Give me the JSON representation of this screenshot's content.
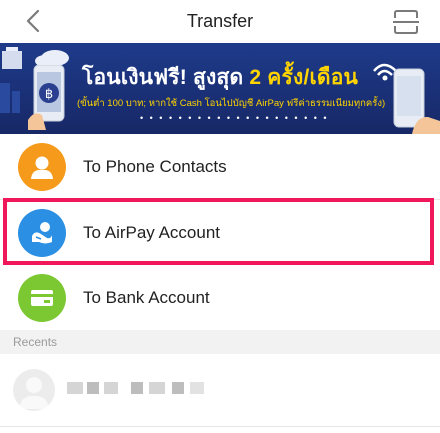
{
  "header": {
    "title": "Transfer",
    "back_icon": "chevron-left-icon",
    "scan_icon": "qr-scan-icon"
  },
  "banner": {
    "headline_part1": "โอนเงินฟรี! สูงสุด ",
    "headline_part2": "2 ครั้ง/เดือน",
    "subtext": "(ขั้นต่ำ 100 บาท; หากใช้ Cash โอนไปบัญชี AirPay ฟรีค่าธรรมเนียมทุกครั้ง)",
    "pager_dots": "• • • • • • • • • • • • • • • • • • • •"
  },
  "options": [
    {
      "label": "To Phone Contacts",
      "icon": "person-icon",
      "color": "#f59a1b"
    },
    {
      "label": "To AirPay Account",
      "icon": "airpay-icon",
      "color": "#2b8fe3"
    },
    {
      "label": "To Bank Account",
      "icon": "card-icon",
      "color": "#7cc832"
    }
  ],
  "recents": {
    "heading": "Recents"
  },
  "colors": {
    "highlight": "#f0185b",
    "banner_bg": "#1e3b8a"
  }
}
